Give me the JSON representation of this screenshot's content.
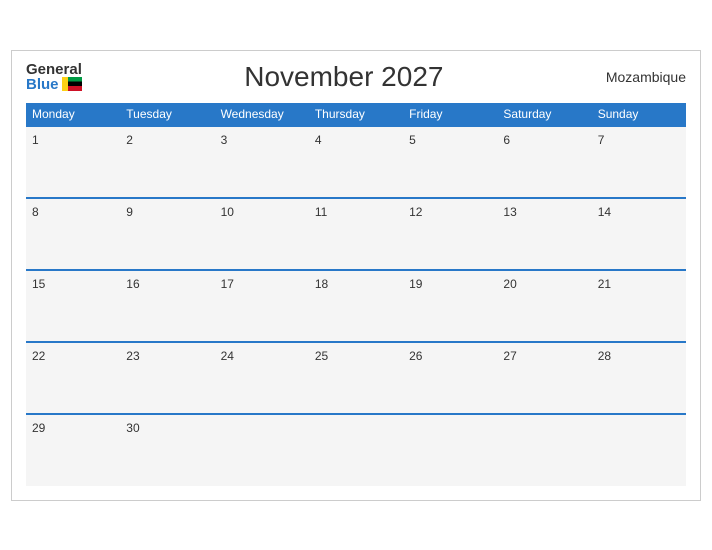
{
  "header": {
    "logo_general": "General",
    "logo_blue": "Blue",
    "title": "November 2027",
    "country": "Mozambique"
  },
  "weekdays": [
    "Monday",
    "Tuesday",
    "Wednesday",
    "Thursday",
    "Friday",
    "Saturday",
    "Sunday"
  ],
  "weeks": [
    [
      1,
      2,
      3,
      4,
      5,
      6,
      7
    ],
    [
      8,
      9,
      10,
      11,
      12,
      13,
      14
    ],
    [
      15,
      16,
      17,
      18,
      19,
      20,
      21
    ],
    [
      22,
      23,
      24,
      25,
      26,
      27,
      28
    ],
    [
      29,
      30,
      null,
      null,
      null,
      null,
      null
    ]
  ]
}
